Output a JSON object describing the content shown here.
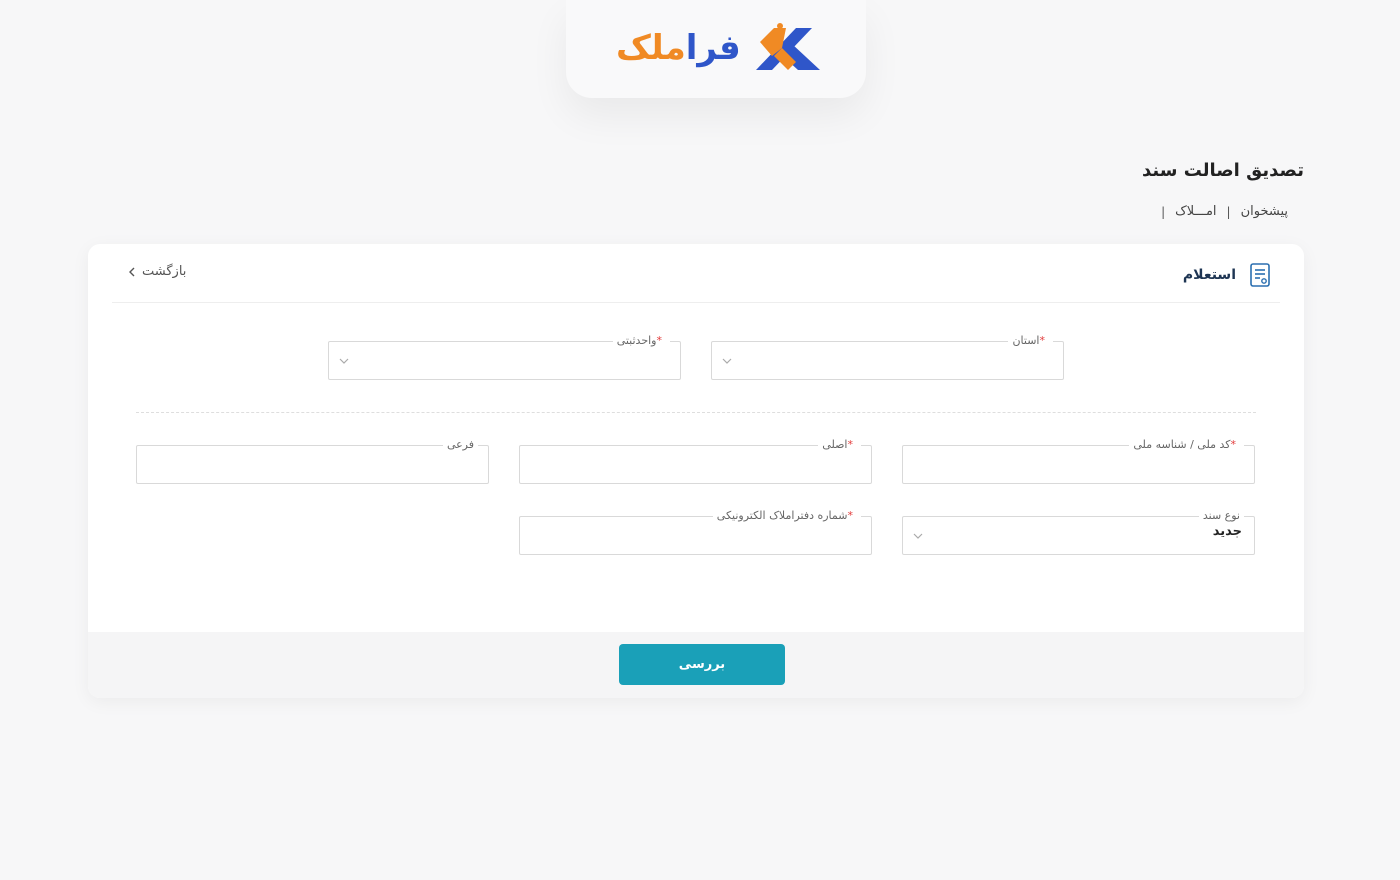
{
  "brand": {
    "name_part1": "فرا",
    "name_part2": "ملک",
    "colors": {
      "blue": "#2f56c9",
      "orange": "#f08a24"
    }
  },
  "page": {
    "title": "تصدیق اصالت سند",
    "breadcrumb": [
      "پیشخوان",
      "امـــلاک"
    ],
    "breadcrumb_separator": "|"
  },
  "card": {
    "title": "استعلام",
    "title_icon": "document-icon",
    "back_label": "بازگشت",
    "back_icon": "chevron-left-icon"
  },
  "form": {
    "province": {
      "label": "استان",
      "required": true,
      "value": ""
    },
    "registry_unit": {
      "label": "واحدثبتی",
      "required": true,
      "value": ""
    },
    "national_id": {
      "label": "کد ملی / شناسه ملی",
      "required": true,
      "value": ""
    },
    "main_plate": {
      "label": "اصلی",
      "required": true,
      "value": ""
    },
    "sub_plate": {
      "label": "فرعی",
      "required": false,
      "value": ""
    },
    "document_type": {
      "label": "نوع سند",
      "required": false,
      "value": "جدید"
    },
    "electronic_book_number": {
      "label": "شماره دفتراملاک الکترونیکی",
      "required": true,
      "value": ""
    }
  },
  "actions": {
    "submit_label": "بررسی",
    "submit_color": "#1aa0b8"
  },
  "required_marker": "*"
}
